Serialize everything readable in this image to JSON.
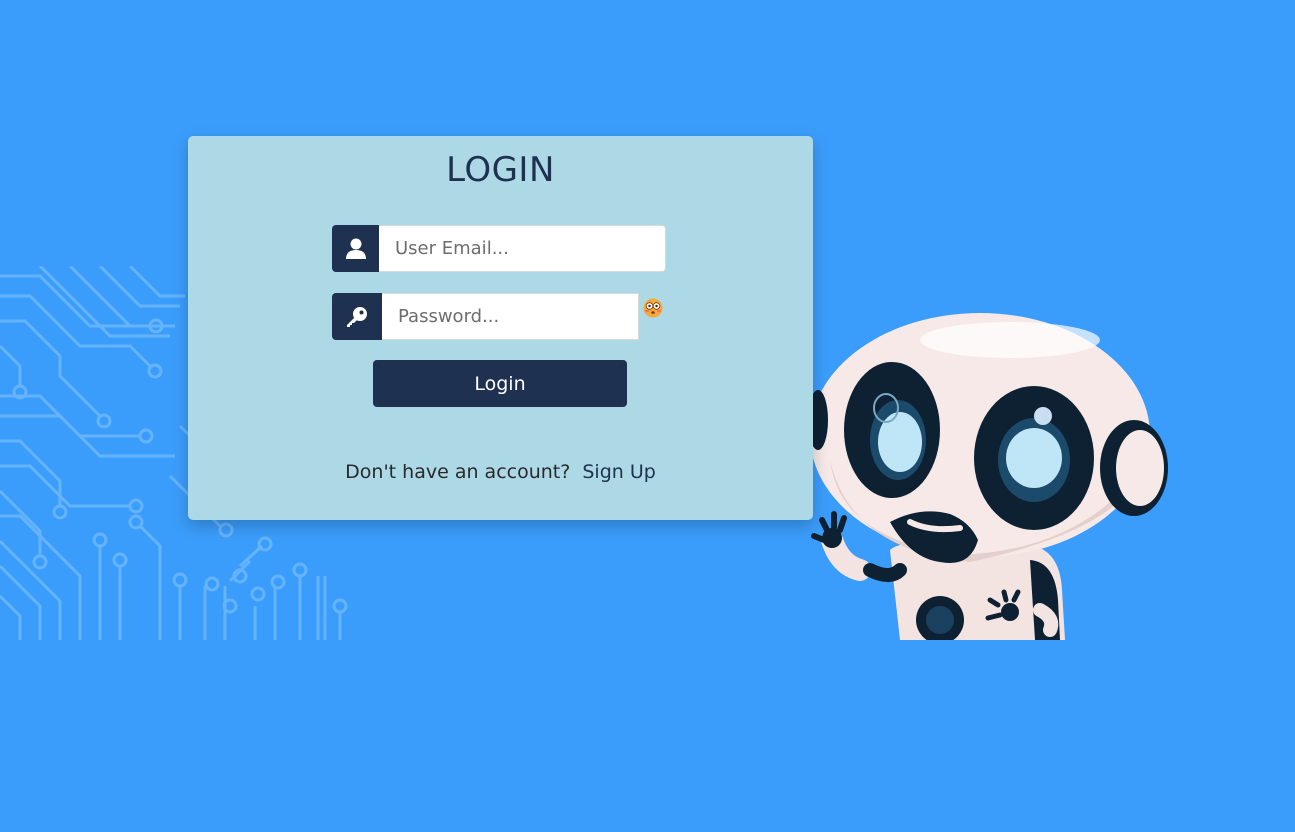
{
  "login_form": {
    "title": "LOGIN",
    "email": {
      "placeholder": "User Email...",
      "value": "",
      "icon": "user-icon"
    },
    "password": {
      "placeholder": "Password...",
      "value": "",
      "icon": "key-icon",
      "toggle_icon": "eye-toggle-emoji-icon"
    },
    "submit_label": "Login",
    "signup_prompt": "Don't have an account?",
    "signup_link": "Sign Up"
  },
  "colors": {
    "background": "#3b9dfb",
    "card": "#add8e6",
    "primary": "#1f3150"
  }
}
